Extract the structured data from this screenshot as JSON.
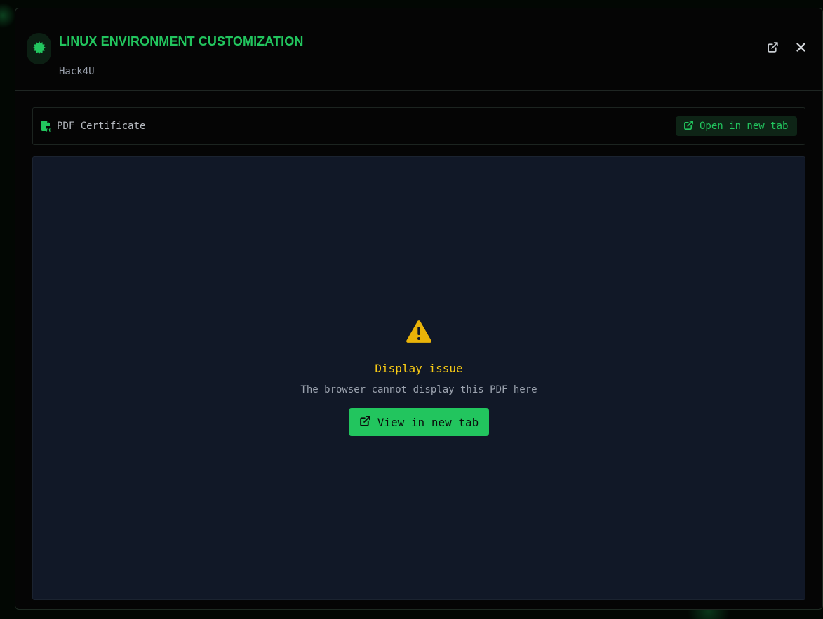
{
  "modal": {
    "title": "LINUX ENVIRONMENT CUSTOMIZATION",
    "issuer": "Hack4U",
    "badge_icon": "gear-badge-icon",
    "header_actions": [
      {
        "icon": "external-link-icon"
      },
      {
        "icon": "close-icon"
      }
    ]
  },
  "file_bar": {
    "icon": "pdf-file-icon",
    "label": "PDF Certificate",
    "open_button_icon": "external-link-icon",
    "open_button_label": "Open in new tab"
  },
  "viewer": {
    "icon": "warning-triangle-icon",
    "issue_title": "Display issue",
    "issue_text": "The browser cannot display this PDF here",
    "button_icon": "external-link-icon",
    "button_label": "View in new tab"
  },
  "colors": {
    "accent": "#22c55e",
    "warning": "#facc15",
    "viewer_bg": "#111827",
    "modal_bg": "#050505"
  }
}
